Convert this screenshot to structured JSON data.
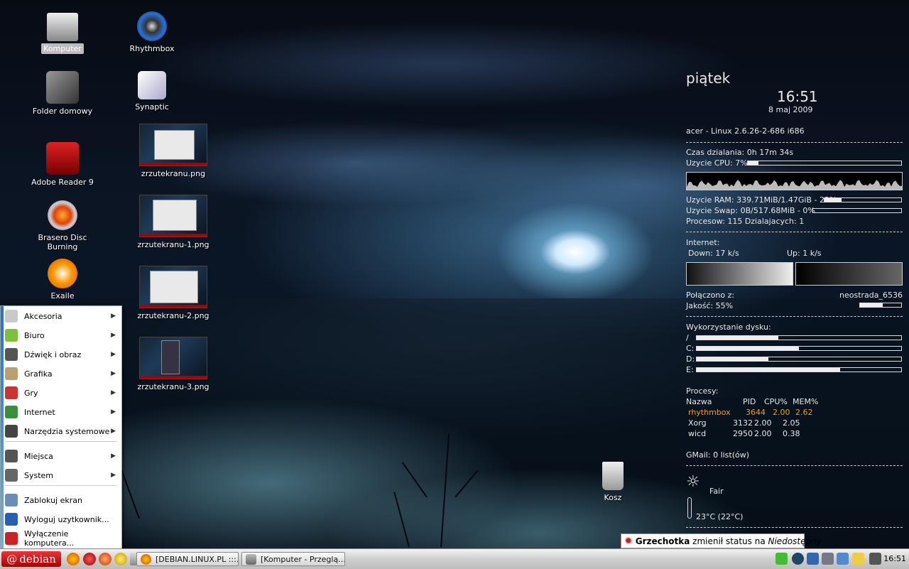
{
  "desktop": {
    "icons_col1": [
      {
        "label": "Komputer",
        "icon": "computer-icon",
        "selected": true
      },
      {
        "label": "Folder domowy",
        "icon": "home-folder-icon"
      },
      {
        "label": "Adobe Reader 9",
        "icon": "adobe-reader-icon"
      },
      {
        "label": "Brasero Disc Burning",
        "icon": "brasero-icon"
      },
      {
        "label": "Exaile",
        "icon": "exaile-icon"
      }
    ],
    "icons_col2": [
      {
        "label": "Rhythmbox",
        "icon": "rhythmbox-icon"
      },
      {
        "label": "Synaptic",
        "icon": "synaptic-icon"
      },
      {
        "label": "zrzutekranu.png",
        "icon": "screenshot-thumbnail"
      },
      {
        "label": "zrzutekranu-1.png",
        "icon": "screenshot-thumbnail"
      },
      {
        "label": "zrzutekranu-2.png",
        "icon": "screenshot-thumbnail"
      },
      {
        "label": "zrzutekranu-3.png",
        "icon": "screenshot-thumbnail"
      }
    ],
    "trash_label": "Kosz"
  },
  "conky": {
    "day": "piątek",
    "time": "16:51",
    "date": "8 maj 2009",
    "system": "acer - Linux 2.6.26-2-686 i686",
    "uptime": "Czas dzialania: 0h 17m 34s",
    "cpu_label": "Uzycie CPU: 7%",
    "cpu_fraction": 0.07,
    "ram_label": "Uzycie RAM: 339.71MiB/1.47GiB - 22%",
    "ram_fraction": 0.22,
    "swap_label": "Uzycie Swap: 0B/517.68MiB - 0%",
    "swap_fraction": 0.0,
    "processes": "Procesow: 115  Dzialajacych: 1",
    "internet_label": "Internet:",
    "down": "Down: 17 k/s",
    "up": "Up: 1 k/s",
    "connected_label": "Połączono z:",
    "network": "neostrada_6536",
    "quality_label": "Jakość: 55%",
    "quality_fraction": 0.55,
    "disk_label": "Wykorzystanie dysku:",
    "disks": [
      {
        "name": "/",
        "fraction": 0.4
      },
      {
        "name": "C:",
        "fraction": 0.5
      },
      {
        "name": "D:",
        "fraction": 0.35
      },
      {
        "name": "E:",
        "fraction": 0.7
      }
    ],
    "proc_title": "Procesy:",
    "proc_header": {
      "name": "Nazwa",
      "pid": "PID",
      "cpu": "CPU%",
      "mem": "MEM%"
    },
    "proc_rows": [
      {
        "name": "rhythmbox",
        "pid": "3644",
        "cpu": "2.00",
        "mem": "2.62",
        "highlight": true
      },
      {
        "name": "Xorg",
        "pid": "3132",
        "cpu": "2.00",
        "mem": "2.05"
      },
      {
        "name": "wicd",
        "pid": "2950",
        "cpu": "2.00",
        "mem": "0.38"
      }
    ],
    "gmail": "GMail: 0 list(ów)",
    "weather": "Fair",
    "temp": "23°C (22°C)",
    "highlight_color": "#e8a020"
  },
  "menu": {
    "items": [
      {
        "label": "Akcesoria",
        "icon": "accessories-icon",
        "submenu": true,
        "color": "#c9c9c9"
      },
      {
        "label": "Biuro",
        "icon": "office-icon",
        "submenu": true,
        "color": "#7fbf3a"
      },
      {
        "label": "Dźwięk i obraz",
        "icon": "sound-video-icon",
        "submenu": true,
        "color": "#555"
      },
      {
        "label": "Grafika",
        "icon": "graphics-icon",
        "submenu": true,
        "color": "#b8a070"
      },
      {
        "label": "Gry",
        "icon": "games-icon",
        "submenu": true,
        "color": "#c33"
      },
      {
        "label": "Internet",
        "icon": "internet-icon",
        "submenu": true,
        "color": "#3a8f3a"
      },
      {
        "label": "Narzędzia systemowe",
        "icon": "system-tools-icon",
        "submenu": true,
        "color": "#444"
      },
      {
        "label": "Miejsca",
        "icon": "places-icon",
        "submenu": true,
        "color": "#555"
      },
      {
        "label": "System",
        "icon": "system-icon",
        "submenu": true,
        "color": "#666"
      },
      {
        "label": "Zablokuj ekran",
        "icon": "lock-screen-icon",
        "submenu": false,
        "color": "#6a8db8"
      },
      {
        "label": "Wyloguj uzytkownik...",
        "icon": "logout-icon",
        "submenu": false,
        "color": "#2a5fb0"
      },
      {
        "label": "Wyłączenie komputera...",
        "icon": "shutdown-icon",
        "submenu": false,
        "color": "#c22"
      }
    ]
  },
  "taskbar": {
    "start_label": "debian",
    "tasks": [
      {
        "label": "[DEBIAN.LINUX.PL :::...",
        "icon": "firefox-icon"
      },
      {
        "label": "[Komputer - Przeglą...",
        "icon": "file-browser-icon"
      }
    ],
    "clock": "16:51"
  },
  "notification": {
    "name": "Grzechotka",
    "text": " zmienił status na ",
    "status": "Niedostępny"
  }
}
